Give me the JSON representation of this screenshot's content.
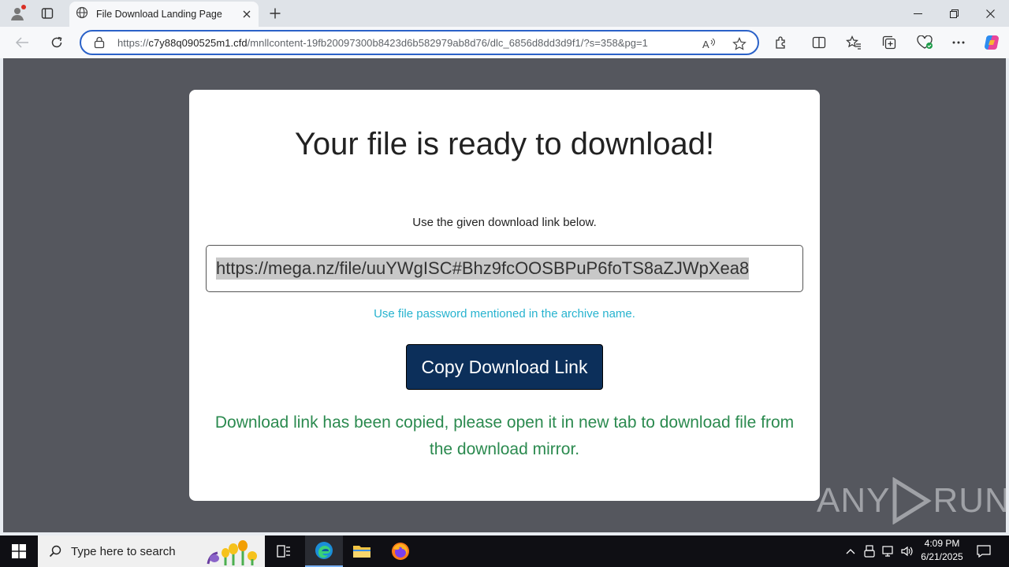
{
  "browser": {
    "tab": {
      "title": "File Download Landing Page"
    },
    "address": {
      "scheme": "https://",
      "host": "c7y88q090525m1.cfd",
      "path": "/mnllcontent-19fb20097300b8423d6b582979ab8d76/dlc_6856d8dd3d9f1/?s=358&pg=1"
    },
    "accent": "#2b62c8"
  },
  "page": {
    "heading": "Your file is ready to download!",
    "subheading": "Use the given download link below.",
    "link_value": "https://mega.nz/file/uuYWgISC#Bhz9fcOOSBPuP6foTS8aZJWpXea8",
    "password_hint": "Use file password mentioned in the archive name.",
    "copy_button": "Copy Download Link",
    "copied_message": "Download link has been copied, please open it in new tab to download file from the download mirror.",
    "colors": {
      "hint": "#27b3cf",
      "button": "#0c2f5a",
      "success": "#2b8a4f"
    }
  },
  "watermark": {
    "left": "ANY",
    "right": "RUN"
  },
  "taskbar": {
    "search_placeholder": "Type here to search",
    "time": "4:09 PM",
    "date": "6/21/2025",
    "apps": [
      "task-view-icon",
      "edge-icon",
      "file-explorer-icon",
      "firefox-icon"
    ]
  }
}
